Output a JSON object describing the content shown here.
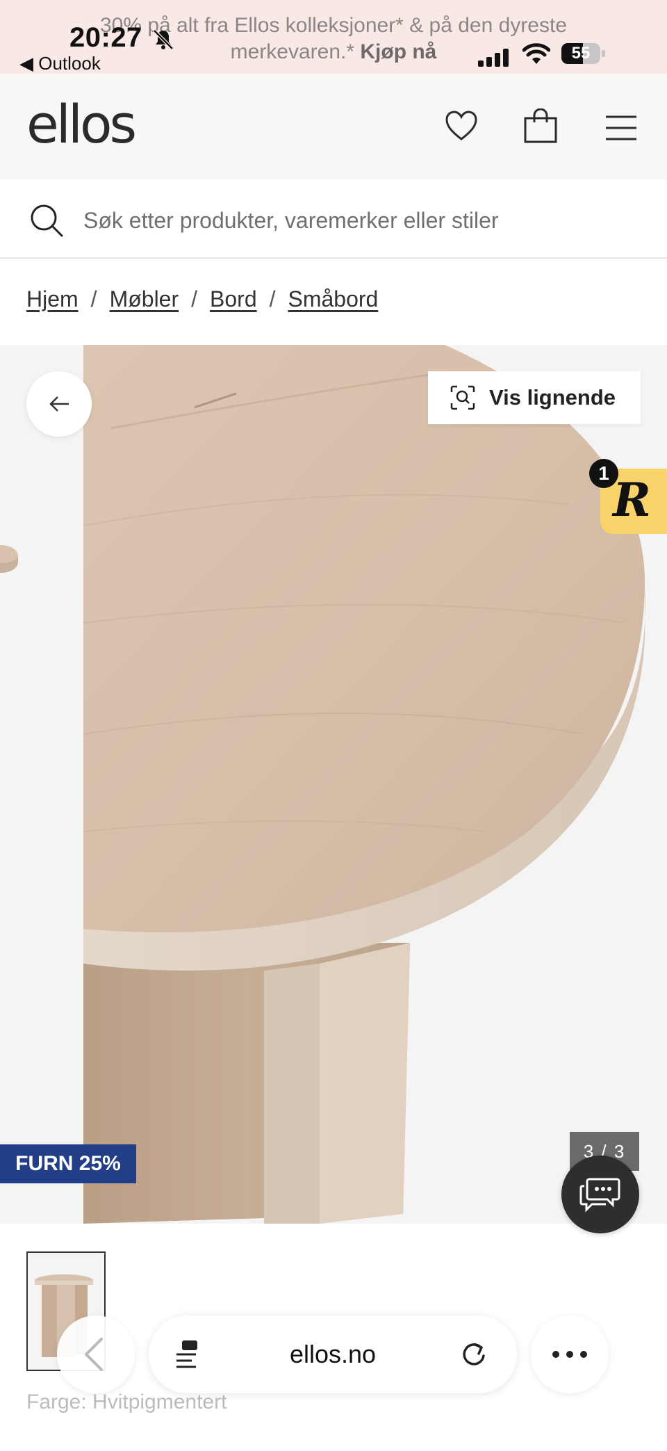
{
  "status_bar": {
    "time": "20:27",
    "back_app": "◀ Outlook",
    "battery_level": "55",
    "battery_fraction": 0.55
  },
  "promo": {
    "line1": "30% på alt fra Ellos kolleksjoner* & på den dyreste",
    "line2": "merkevaren.*",
    "cta": "Kjøp nå"
  },
  "header": {
    "logo": "ellos",
    "icons": [
      "heart-icon",
      "bag-icon",
      "menu-icon"
    ]
  },
  "search": {
    "placeholder": "Søk etter produkter, varemerker eller stiler"
  },
  "breadcrumb": {
    "items": [
      "Hjem",
      "Møbler",
      "Bord",
      "Småbord"
    ],
    "separator": "/"
  },
  "gallery": {
    "similar_label": "Vis lignende",
    "widget_letter": "R",
    "widget_badge": "1",
    "discount_badge": "FURN 25%",
    "pager": "3 / 3"
  },
  "product": {
    "color_label": "Farge: Hvitpigmentert"
  },
  "browser": {
    "address": "ellos.no"
  },
  "colors": {
    "promo_bg": "#f8e9e7",
    "header_bg": "#f9f7f5",
    "discount_badge": "#223e87",
    "widget": "#f9d36a",
    "wood": "#d9c2ae"
  }
}
